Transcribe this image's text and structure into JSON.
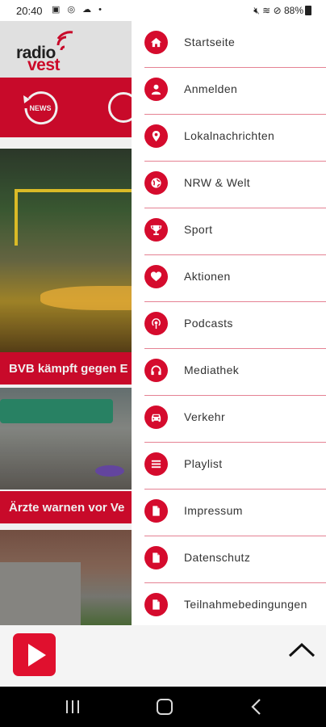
{
  "status_bar": {
    "time": "20:40",
    "battery": "88%"
  },
  "app": {
    "logo": {
      "line1": "radio",
      "line2": "vest"
    },
    "news_icon_label": "NEWS",
    "article_titles": [
      "BVB kämpft gegen E",
      "Ärzte warnen vor Ve"
    ],
    "brand_color": "#d50b2d"
  },
  "drawer": {
    "items": [
      {
        "label": "Startseite",
        "icon": "home-icon"
      },
      {
        "label": "Anmelden",
        "icon": "person-icon"
      },
      {
        "label": "Lokalnachrichten",
        "icon": "location-pin-icon"
      },
      {
        "label": "NRW & Welt",
        "icon": "globe-icon"
      },
      {
        "label": "Sport",
        "icon": "trophy-icon"
      },
      {
        "label": "Aktionen",
        "icon": "heart-icon"
      },
      {
        "label": "Podcasts",
        "icon": "podcast-icon"
      },
      {
        "label": "Mediathek",
        "icon": "headphones-icon"
      },
      {
        "label": "Verkehr",
        "icon": "car-icon"
      },
      {
        "label": "Playlist",
        "icon": "list-icon"
      },
      {
        "label": "Impressum",
        "icon": "document-icon"
      },
      {
        "label": "Datenschutz",
        "icon": "document-icon"
      },
      {
        "label": "Teilnahmebedingungen",
        "icon": "document-icon"
      }
    ]
  }
}
